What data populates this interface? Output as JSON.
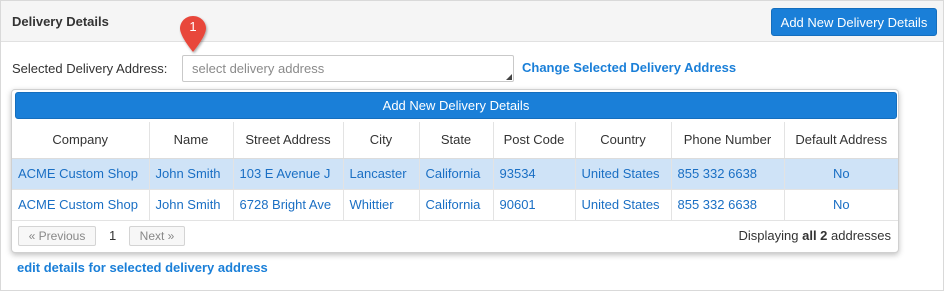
{
  "panel": {
    "title": "Delivery Details",
    "add_button_label": "Add New Delivery Details"
  },
  "address": {
    "label": "Selected Delivery Address:",
    "placeholder": "select delivery address",
    "value": "",
    "change_link": "Change Selected Delivery Address"
  },
  "marker": {
    "number": "1"
  },
  "dropdown": {
    "add_button_label": "Add New Delivery Details",
    "columns": [
      "Company",
      "Name",
      "Street Address",
      "City",
      "State",
      "Post Code",
      "Country",
      "Phone Number",
      "Default Address"
    ],
    "rows": [
      {
        "selected": true,
        "cells": [
          "ACME Custom Shop",
          "John Smith",
          "103 E Avenue J",
          "Lancaster",
          "California",
          "93534",
          "United States",
          "855 332 6638",
          "No"
        ]
      },
      {
        "selected": false,
        "cells": [
          "ACME Custom Shop",
          "John Smith",
          "6728 Bright Ave",
          "Whittier",
          "California",
          "90601",
          "United States",
          "855 332 6638",
          "No"
        ]
      }
    ],
    "pager": {
      "prev_label": "« Previous",
      "current_page": "1",
      "next_label": "Next »",
      "displaying_prefix": "Displaying ",
      "displaying_bold": "all 2",
      "displaying_suffix": " addresses"
    }
  },
  "edit_link": "edit details for selected delivery address",
  "colors": {
    "accent": "#1a7fd8",
    "link": "#1a6fc4",
    "selected_row": "#cfe3f7",
    "marker": "#e8473a"
  }
}
